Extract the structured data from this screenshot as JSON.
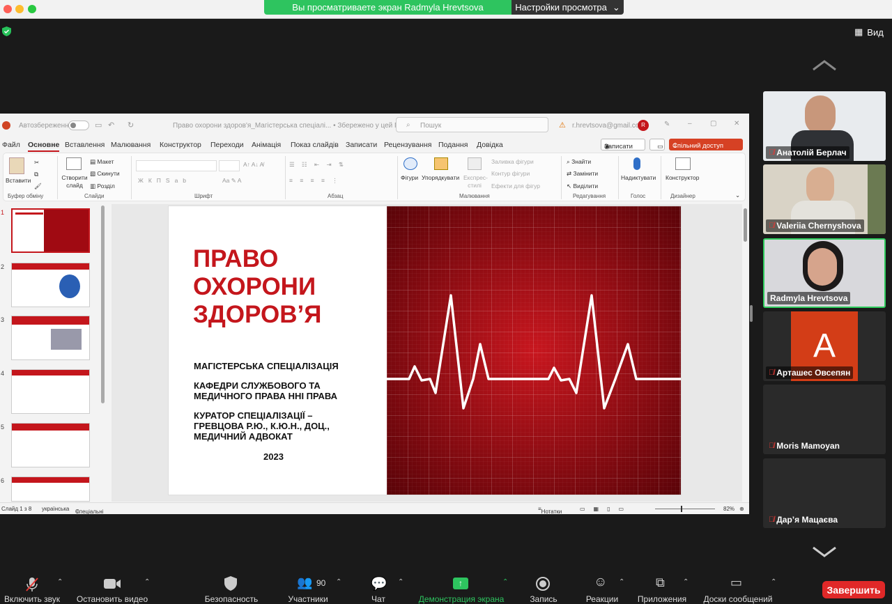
{
  "banner": {
    "sharing_text": "Вы просматриваете экран Radmyla Hrevtsova",
    "view_settings": "Настройки просмотра"
  },
  "view_button": "Вид",
  "ppt": {
    "autosave": "Автозбереження",
    "doc_title": "Право охорони здоров'я_Магістерська спеціалі... • Збережено у цей ПК",
    "search_placeholder": "Пошук",
    "account": "r.hrevtsova@gmail.com",
    "avatar": "R",
    "record_btn": "Записати",
    "share_btn": "Спільний доступ",
    "menu": [
      "Файл",
      "Основне",
      "Вставлення",
      "Малювання",
      "Конструктор",
      "Переходи",
      "Анімація",
      "Показ слайдів",
      "Записати",
      "Рецензування",
      "Подання",
      "Довідка"
    ],
    "ribbon": {
      "paste": "Вставити",
      "new_slide": "Створити слайд",
      "layout": "Макет",
      "reset": "Скинути",
      "section": "Розділ",
      "shapes": "Фігури",
      "arrange": "Упорядкувати",
      "quick_styles": "Експрес-стилі",
      "shape_fill": "Заливка фігури",
      "shape_outline": "Контур фігури",
      "shape_effects": "Ефекти для фігур",
      "find": "Знайти",
      "replace": "Замінити",
      "select": "Виділити",
      "dictate": "Надиктувати",
      "designer": "Конструктор",
      "groups": [
        "Буфер обміну",
        "Слайди",
        "Шрифт",
        "Абзац",
        "Малювання",
        "Редагування",
        "Голос",
        "Дизайнер"
      ]
    },
    "slides": [
      "1",
      "2",
      "3",
      "4",
      "5",
      "6"
    ],
    "slide": {
      "title": [
        "ПРАВО",
        "ОХОРОНИ",
        "ЗДОРОВ’Я"
      ],
      "line1": "МАГІСТЕРСЬКА СПЕЦІАЛІЗАЦІЯ",
      "line2a": "КАФЕДРИ СЛУЖБОВОГО ТА",
      "line2b": "МЕДИЧНОГО ПРАВА ННІ ПРАВА",
      "line3a": "КУРАТОР СПЕЦІАЛІЗАЦІЇ –",
      "line3b": "ГРЕВЦОВА Р.Ю., К.Ю.Н., ДОЦ.,",
      "line3c": "МЕДИЧНИЙ АДВОКАТ",
      "year": "2023"
    },
    "status": {
      "slide_count": "Слайд 1 з 8",
      "language": "українська",
      "accessibility": "Спеціальні можливості: щось не так",
      "notes": "Нотатки",
      "zoom": "82%"
    }
  },
  "participants": [
    {
      "name": "Анатолій Берлач",
      "muted": true,
      "video": true
    },
    {
      "name": "Valeriia Chernyshova",
      "muted": true,
      "video": true
    },
    {
      "name": "Radmyla Hrevtsova",
      "muted": false,
      "video": true,
      "active": true
    },
    {
      "name": "Арташес Овсепян",
      "muted": true,
      "avatar_letter": "А"
    },
    {
      "name": "Moris Mamoyan",
      "muted": true
    },
    {
      "name": "Дар’я Мацаєва",
      "muted": true
    }
  ],
  "toolbar": {
    "unmute": "Включить звук",
    "stop_video": "Остановить видео",
    "security": "Безопасность",
    "participants": "Участники",
    "participants_count": "90",
    "chat": "Чат",
    "share_screen": "Демонстрация экрана",
    "record": "Запись",
    "reactions": "Реакции",
    "apps": "Приложения",
    "whiteboards": "Доски сообщений",
    "end": "Завершить"
  },
  "colors": {
    "accent_green": "#2ec45f",
    "end_red": "#e02828",
    "slide_red": "#c4161c",
    "share_btn": "#d64124"
  }
}
